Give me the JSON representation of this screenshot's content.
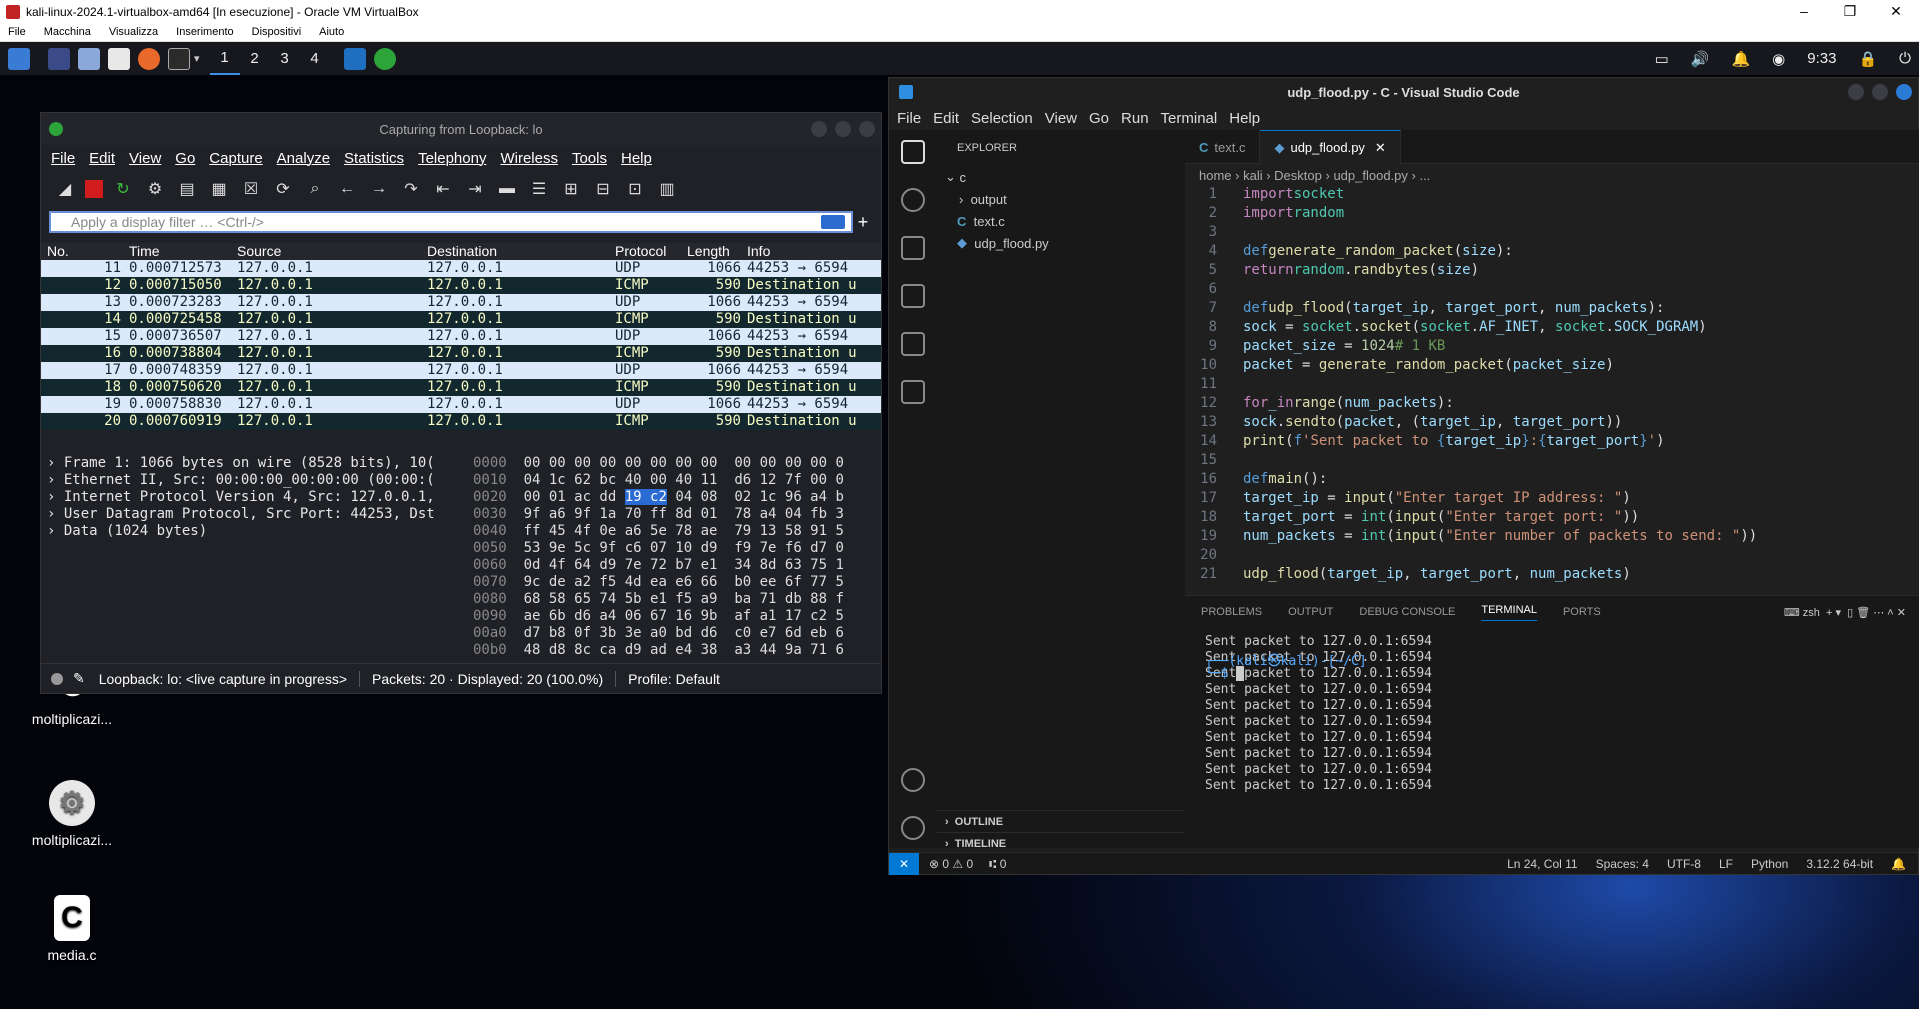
{
  "vbox": {
    "title": "kali-linux-2024.1-virtualbox-amd64 [In esecuzione] - Oracle VM VirtualBox",
    "menu": [
      "File",
      "Macchina",
      "Visualizza",
      "Inserimento",
      "Dispositivi",
      "Aiuto"
    ],
    "controls": [
      "–",
      "❐",
      "✕"
    ]
  },
  "panel": {
    "workspaces": [
      "1",
      "2",
      "3",
      "4"
    ],
    "clock": "9:33"
  },
  "desktop": {
    "icons": [
      {
        "label": "moltiplicazi..."
      },
      {
        "label": "moltiplicazi..."
      },
      {
        "label": "media.c",
        "glyph": "C"
      }
    ]
  },
  "wireshark": {
    "title": "Capturing from Loopback: lo",
    "menu": [
      "File",
      "Edit",
      "View",
      "Go",
      "Capture",
      "Analyze",
      "Statistics",
      "Telephony",
      "Wireless",
      "Tools",
      "Help"
    ],
    "filter_placeholder": "Apply a display filter … <Ctrl-/>",
    "columns": [
      "No.",
      "Time",
      "Source",
      "Destination",
      "Protocol",
      "Length",
      "Info"
    ],
    "packets": [
      {
        "no": "11",
        "time": "0.000712573",
        "src": "127.0.0.1",
        "dst": "127.0.0.1",
        "proto": "UDP",
        "len": "1066",
        "info": "44253 → 6594"
      },
      {
        "no": "12",
        "time": "0.000715050",
        "src": "127.0.0.1",
        "dst": "127.0.0.1",
        "proto": "ICMP",
        "len": "590",
        "info": "Destination u"
      },
      {
        "no": "13",
        "time": "0.000723283",
        "src": "127.0.0.1",
        "dst": "127.0.0.1",
        "proto": "UDP",
        "len": "1066",
        "info": "44253 → 6594"
      },
      {
        "no": "14",
        "time": "0.000725458",
        "src": "127.0.0.1",
        "dst": "127.0.0.1",
        "proto": "ICMP",
        "len": "590",
        "info": "Destination u"
      },
      {
        "no": "15",
        "time": "0.000736507",
        "src": "127.0.0.1",
        "dst": "127.0.0.1",
        "proto": "UDP",
        "len": "1066",
        "info": "44253 → 6594"
      },
      {
        "no": "16",
        "time": "0.000738804",
        "src": "127.0.0.1",
        "dst": "127.0.0.1",
        "proto": "ICMP",
        "len": "590",
        "info": "Destination u"
      },
      {
        "no": "17",
        "time": "0.000748359",
        "src": "127.0.0.1",
        "dst": "127.0.0.1",
        "proto": "UDP",
        "len": "1066",
        "info": "44253 → 6594"
      },
      {
        "no": "18",
        "time": "0.000750620",
        "src": "127.0.0.1",
        "dst": "127.0.0.1",
        "proto": "ICMP",
        "len": "590",
        "info": "Destination u"
      },
      {
        "no": "19",
        "time": "0.000758830",
        "src": "127.0.0.1",
        "dst": "127.0.0.1",
        "proto": "UDP",
        "len": "1066",
        "info": "44253 → 6594"
      },
      {
        "no": "20",
        "time": "0.000760919",
        "src": "127.0.0.1",
        "dst": "127.0.0.1",
        "proto": "ICMP",
        "len": "590",
        "info": "Destination u"
      }
    ],
    "details": [
      "Frame 1: 1066 bytes on wire (8528 bits), 10(",
      "Ethernet II, Src: 00:00:00_00:00:00 (00:00:(",
      "Internet Protocol Version 4, Src: 127.0.0.1,",
      "User Datagram Protocol, Src Port: 44253, Dst",
      "Data (1024 bytes)"
    ],
    "hex": [
      {
        "off": "0000",
        "a": "00 00 00 00 00 00 00 00",
        "b": "00 00 00 00 0"
      },
      {
        "off": "0010",
        "a": "04 1c 62 bc 40 00 40 11",
        "b": "d6 12 7f 00 0"
      },
      {
        "off": "0020",
        "a1": "00 01 ac dd ",
        "sel": "19 c2",
        "a2": " 04 08",
        "b": "02 1c 96 a4 b"
      },
      {
        "off": "0030",
        "a": "9f a6 9f 1a 70 ff 8d 01",
        "b": "78 a4 04 fb 3"
      },
      {
        "off": "0040",
        "a": "ff 45 4f 0e a6 5e 78 ae",
        "b": "79 13 58 91 5"
      },
      {
        "off": "0050",
        "a": "53 9e 5c 9f c6 07 10 d9",
        "b": "f9 7e f6 d7 0"
      },
      {
        "off": "0060",
        "a": "0d 4f 64 d9 7e 72 b7 e1",
        "b": "34 8d 63 75 1"
      },
      {
        "off": "0070",
        "a": "9c de a2 f5 4d ea e6 66",
        "b": "b0 ee 6f 77 5"
      },
      {
        "off": "0080",
        "a": "68 58 65 74 5b e1 f5 a9",
        "b": "ba 71 db 88 f"
      },
      {
        "off": "0090",
        "a": "ae 6b d6 a4 06 67 16 9b",
        "b": "af a1 17 c2 5"
      },
      {
        "off": "00a0",
        "a": "d7 b8 0f 3b 3e a0 bd d6",
        "b": "c0 e7 6d eb 6"
      },
      {
        "off": "00b0",
        "a": "48 d8 8c ca d9 ad e4 38",
        "b": "a3 44 9a 71 6"
      }
    ],
    "status": {
      "iface": "Loopback: lo: <live capture in progress>",
      "packets": "Packets: 20 · Displayed: 20 (100.0%)",
      "profile": "Profile: Default"
    }
  },
  "vscode": {
    "title": "udp_flood.py - C - Visual Studio Code",
    "menu": [
      "File",
      "Edit",
      "Selection",
      "View",
      "Go",
      "Run",
      "Terminal",
      "Help"
    ],
    "explorer": {
      "heading": "EXPLORER",
      "folder": "c",
      "items": [
        "output",
        "text.c",
        "udp_flood.py"
      ],
      "outline": "OUTLINE",
      "timeline": "TIMELINE"
    },
    "tabs": [
      "text.c",
      "udp_flood.py"
    ],
    "breadcrumb": [
      "home",
      "kali",
      "Desktop",
      "udp_flood.py",
      "..."
    ],
    "terminal_tabs": [
      "PROBLEMS",
      "OUTPUT",
      "DEBUG CONSOLE",
      "TERMINAL",
      "PORTS"
    ],
    "terminal_lines": [
      "Sent packet to 127.0.0.1:6594",
      "Sent packet to 127.0.0.1:6594",
      "Sent packet to 127.0.0.1:6594",
      "Sent packet to 127.0.0.1:6594",
      "Sent packet to 127.0.0.1:6594",
      "Sent packet to 127.0.0.1:6594",
      "Sent packet to 127.0.0.1:6594",
      "Sent packet to 127.0.0.1:6594",
      "Sent packet to 127.0.0.1:6594",
      "Sent packet to 127.0.0.1:6594"
    ],
    "prompt": "┌──(kali㉿kali)-[~/C]",
    "prompt2": "└─$ ",
    "shell": "zsh",
    "status": {
      "errors": "⊗ 0 ⚠ 0",
      "ports": "⑆ 0",
      "pos": "Ln 24, Col 11",
      "spaces": "Spaces: 4",
      "enc": "UTF-8",
      "eol": "LF",
      "lang": "Python",
      "interp": "3.12.2 64-bit"
    }
  }
}
